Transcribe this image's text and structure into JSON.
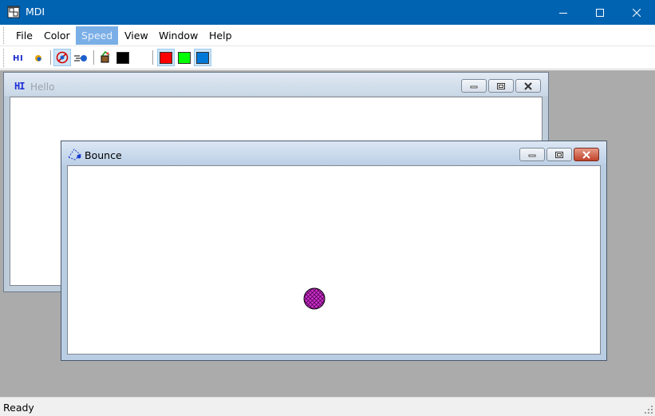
{
  "window": {
    "title": "MDI"
  },
  "menu": [
    {
      "label": "File"
    },
    {
      "label": "Color"
    },
    {
      "label": "Speed",
      "active": true
    },
    {
      "label": "View"
    },
    {
      "label": "Window"
    },
    {
      "label": "Help"
    }
  ],
  "toolbar": {
    "colors": {
      "black": "#000000",
      "red": "#ff0000",
      "green": "#00ff00",
      "blue": "#0078d7"
    }
  },
  "hello_window": {
    "icon_text": "HI",
    "title": "Hello"
  },
  "bounce_window": {
    "title": "Bounce",
    "ball_color": "#cc33cc"
  },
  "status": {
    "text": "Ready"
  }
}
